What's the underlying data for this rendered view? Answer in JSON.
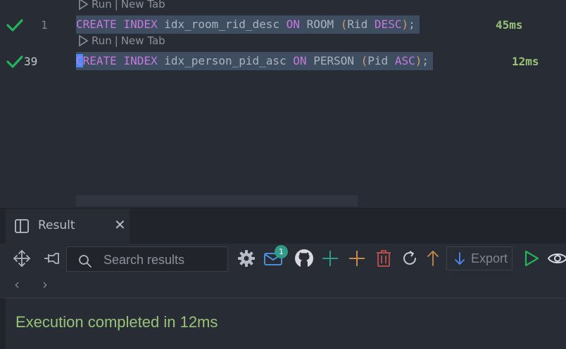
{
  "editor": {
    "codelens": {
      "run": "Run",
      "sep": "|",
      "new_tab": "New Tab"
    },
    "statements": [
      {
        "line": "1",
        "status_icon": "check-icon",
        "parts": [
          "CREATE",
          "INDEX",
          "idx_room_rid_desc",
          "ON",
          "ROOM",
          "(",
          "Rid",
          "DESC",
          ")",
          ";"
        ],
        "duration": "45ms"
      },
      {
        "line": "39",
        "status_icon": "check-icon",
        "parts": [
          "C",
          "REATE",
          "INDEX",
          "idx_person_pid_asc",
          "ON",
          "PERSON",
          "(",
          "Pid",
          "ASC",
          ")",
          ";"
        ],
        "duration": "12ms"
      }
    ]
  },
  "result_panel": {
    "tab_label": "Result",
    "tab_close": "✕",
    "search_placeholder": "Search results",
    "notification_count": "1",
    "export_label": "Export",
    "nav_prev": "‹",
    "nav_next": "›",
    "message": "Execution completed in 12ms"
  },
  "colors": {
    "background": "#282c34",
    "keyword": "#c678dd",
    "success": "#98c379",
    "selection": "#3e4d5f",
    "accent_add": "#2f9b88",
    "accent_orange": "#c9894d",
    "accent_red": "#c0504d"
  },
  "toolbar_icons": [
    "move-icon",
    "pin-icon",
    "search-icon",
    "gear-icon",
    "mail-icon",
    "github-icon",
    "add-row-icon",
    "add-column-icon",
    "delete-icon",
    "refresh-icon",
    "sort-up-icon",
    "export-arrow-icon",
    "run-icon",
    "preview-eye-icon"
  ]
}
